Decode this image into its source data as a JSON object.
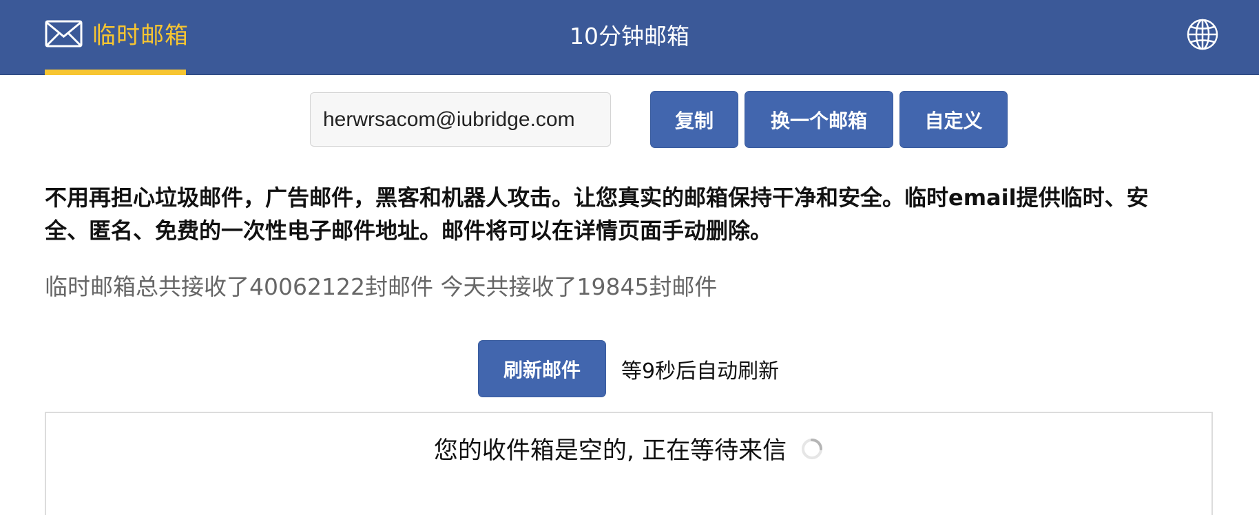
{
  "header": {
    "brand_label": "临时邮箱",
    "page_title": "10分钟邮箱",
    "brand_color": "#f7c531",
    "bar_color": "#3b5998",
    "brand_icon": "mail-icon",
    "language_icon": "globe-icon"
  },
  "email": {
    "address": "herwrsacom@iubridge.com",
    "copy_label": "复制",
    "change_label": "换一个邮箱",
    "custom_label": "自定义"
  },
  "intro": {
    "description": "不用再担心垃圾邮件，广告邮件，黑客和机器人攻击。让您真实的邮箱保持干净和安全。临时email提供临时、安全、匿名、免费的一次性电子邮件地址。邮件将可以在详情页面手动删除。",
    "stats": "临时邮箱总共接收了40062122封邮件 今天共接收了19845封邮件"
  },
  "refresh": {
    "button_label": "刷新邮件",
    "auto_refresh_text": "等9秒后自动刷新"
  },
  "inbox": {
    "empty_message": "您的收件箱是空的, 正在等待来信",
    "spinner_icon": "loading-spinner-icon"
  },
  "colors": {
    "button_blue": "#4266ae"
  }
}
